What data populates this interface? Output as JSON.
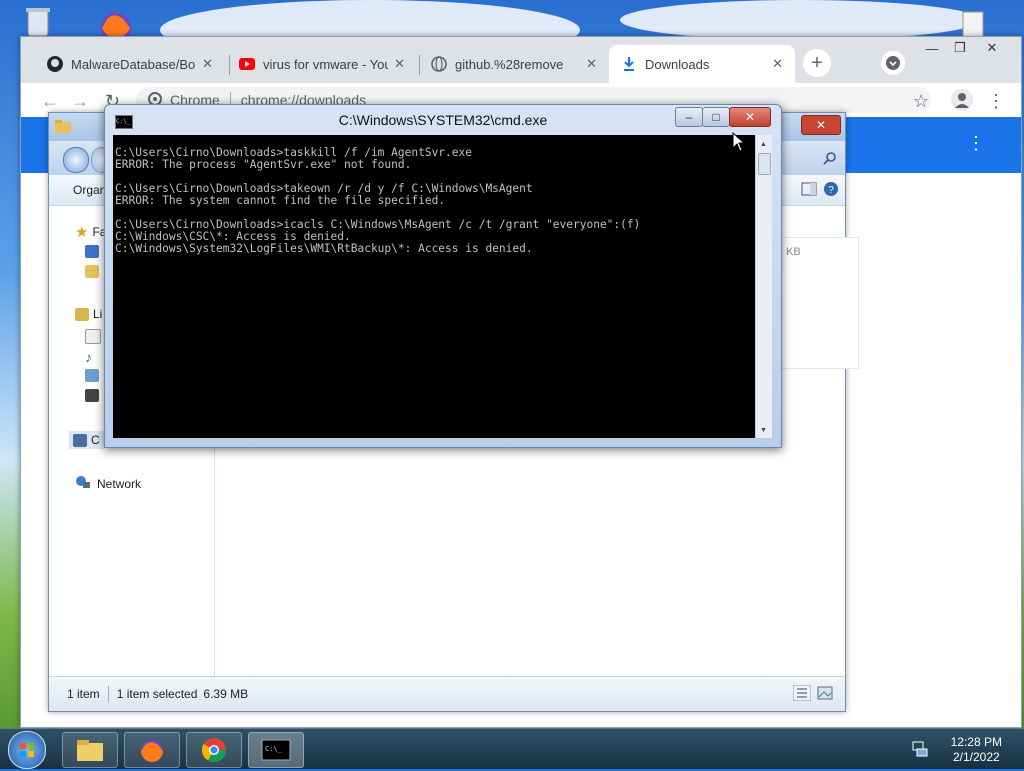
{
  "chrome": {
    "tabs": [
      {
        "label": "MalwareDatabase/Bonz",
        "icon": "github-icon",
        "close": "✕"
      },
      {
        "label": "virus for vmware - YouT",
        "icon": "youtube-icon",
        "close": "✕"
      },
      {
        "label": "github.%28remove",
        "icon": "globe-icon",
        "close": "✕"
      },
      {
        "label": "Downloads",
        "icon": "download-icon",
        "close": "✕"
      }
    ],
    "new_tab": "+",
    "url_site": "Chrome",
    "url_path": "chrome://downloads",
    "window_min": "—",
    "window_max": "❐",
    "window_close": "✕"
  },
  "explorer": {
    "toolbar_organize": "Organ",
    "nav": {
      "favorites": "Fa",
      "libraries": "Li",
      "computer": "C",
      "network": "Network"
    },
    "size_hint": "KB",
    "status_count": "1 item",
    "status_selected": "1 item selected",
    "status_size": "6.39 MB"
  },
  "cmd": {
    "title": "C:\\Windows\\SYSTEM32\\cmd.exe",
    "lines": "C:\\Users\\Cirno\\Downloads>taskkill /f /im AgentSvr.exe\nERROR: The process \"AgentSvr.exe\" not found.\n\nC:\\Users\\Cirno\\Downloads>takeown /r /d y /f C:\\Windows\\MsAgent\nERROR: The system cannot find the file specified.\n\nC:\\Users\\Cirno\\Downloads>icacls C:\\Windows\\MsAgent /c /t /grant \"everyone\":(f)\nC:\\Windows\\CSC\\*: Access is denied.\nC:\\Windows\\System32\\LogFiles\\WMI\\RtBackup\\*: Access is denied."
  },
  "taskbar": {
    "time": "12:28 PM",
    "date": "2/1/2022"
  },
  "colors": {
    "chrome_blue": "#1a73e8",
    "console_bg": "#000000",
    "console_fg": "#c0c0c0"
  }
}
